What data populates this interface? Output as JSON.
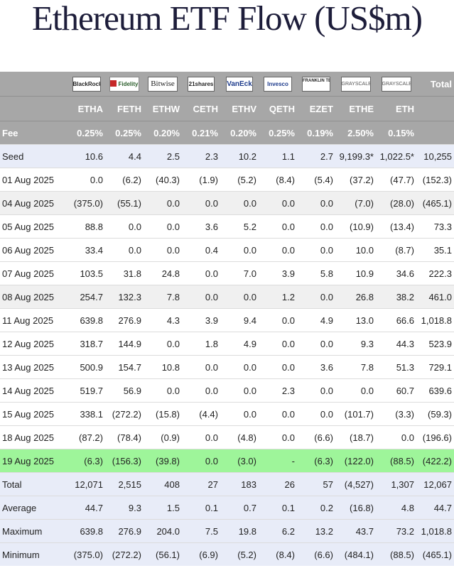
{
  "title": "Ethereum ETF Flow (US$m)",
  "issuers": [
    {
      "logo": "BlackRock",
      "icon": "blackrock-logo"
    },
    {
      "logo": "Fidelity",
      "icon": "fidelity-logo"
    },
    {
      "logo": "Bitwise",
      "icon": "bitwise-logo"
    },
    {
      "logo": "21shares",
      "icon": "21shares-logo"
    },
    {
      "logo": "VanEck",
      "icon": "vaneck-logo"
    },
    {
      "logo": "Invesco",
      "icon": "invesco-logo"
    },
    {
      "logo": "FRANKLIN TEMPLETON",
      "icon": "franklin-templeton-logo"
    },
    {
      "logo": "GRAYSCALE",
      "icon": "grayscale-logo"
    },
    {
      "logo": "GRAYSCALE",
      "icon": "grayscale-logo"
    }
  ],
  "total_header": "Total",
  "tickers": [
    "ETHA",
    "FETH",
    "ETHW",
    "CETH",
    "ETHV",
    "QETH",
    "EZET",
    "ETHE",
    "ETH"
  ],
  "fee_label": "Fee",
  "fees": [
    "0.25%",
    "0.25%",
    "0.20%",
    "0.21%",
    "0.20%",
    "0.25%",
    "0.19%",
    "2.50%",
    "0.15%"
  ],
  "rows": [
    {
      "label": "Seed",
      "style": "seed",
      "values": [
        "10.6",
        "4.4",
        "2.5",
        "2.3",
        "10.2",
        "1.1",
        "2.7",
        "9,199.3*",
        "1,022.5*",
        "10,255"
      ]
    },
    {
      "label": "01 Aug 2025",
      "style": "white",
      "values": [
        "0.0",
        "(6.2)",
        "(40.3)",
        "(1.9)",
        "(5.2)",
        "(8.4)",
        "(5.4)",
        "(37.2)",
        "(47.7)",
        "(152.3)"
      ]
    },
    {
      "label": "04 Aug 2025",
      "style": "gray",
      "values": [
        "(375.0)",
        "(55.1)",
        "0.0",
        "0.0",
        "0.0",
        "0.0",
        "0.0",
        "(7.0)",
        "(28.0)",
        "(465.1)"
      ]
    },
    {
      "label": "05 Aug 2025",
      "style": "white",
      "values": [
        "88.8",
        "0.0",
        "0.0",
        "3.6",
        "5.2",
        "0.0",
        "0.0",
        "(10.9)",
        "(13.4)",
        "73.3"
      ]
    },
    {
      "label": "06 Aug 2025",
      "style": "white",
      "values": [
        "33.4",
        "0.0",
        "0.0",
        "0.4",
        "0.0",
        "0.0",
        "0.0",
        "10.0",
        "(8.7)",
        "35.1"
      ]
    },
    {
      "label": "07 Aug 2025",
      "style": "white",
      "values": [
        "103.5",
        "31.8",
        "24.8",
        "0.0",
        "7.0",
        "3.9",
        "5.8",
        "10.9",
        "34.6",
        "222.3"
      ]
    },
    {
      "label": "08 Aug 2025",
      "style": "gray",
      "values": [
        "254.7",
        "132.3",
        "7.8",
        "0.0",
        "0.0",
        "1.2",
        "0.0",
        "26.8",
        "38.2",
        "461.0"
      ]
    },
    {
      "label": "11 Aug 2025",
      "style": "white",
      "values": [
        "639.8",
        "276.9",
        "4.3",
        "3.9",
        "9.4",
        "0.0",
        "4.9",
        "13.0",
        "66.6",
        "1,018.8"
      ]
    },
    {
      "label": "12 Aug 2025",
      "style": "white",
      "values": [
        "318.7",
        "144.9",
        "0.0",
        "1.8",
        "4.9",
        "0.0",
        "0.0",
        "9.3",
        "44.3",
        "523.9"
      ]
    },
    {
      "label": "13 Aug 2025",
      "style": "white",
      "values": [
        "500.9",
        "154.7",
        "10.8",
        "0.0",
        "0.0",
        "0.0",
        "3.6",
        "7.8",
        "51.3",
        "729.1"
      ]
    },
    {
      "label": "14 Aug 2025",
      "style": "white",
      "values": [
        "519.7",
        "56.9",
        "0.0",
        "0.0",
        "0.0",
        "2.3",
        "0.0",
        "0.0",
        "60.7",
        "639.6"
      ]
    },
    {
      "label": "15 Aug 2025",
      "style": "white",
      "values": [
        "338.1",
        "(272.2)",
        "(15.8)",
        "(4.4)",
        "0.0",
        "0.0",
        "0.0",
        "(101.7)",
        "(3.3)",
        "(59.3)"
      ]
    },
    {
      "label": "18 Aug 2025",
      "style": "white",
      "values": [
        "(87.2)",
        "(78.4)",
        "(0.9)",
        "0.0",
        "(4.8)",
        "0.0",
        "(6.6)",
        "(18.7)",
        "0.0",
        "(196.6)"
      ]
    },
    {
      "label": "19 Aug 2025",
      "style": "green",
      "values": [
        "(6.3)",
        "(156.3)",
        "(39.8)",
        "0.0",
        "(3.0)",
        "-",
        "(6.3)",
        "(122.0)",
        "(88.5)",
        "(422.2)"
      ]
    }
  ],
  "stats": [
    {
      "label": "Total",
      "values": [
        "12,071",
        "2,515",
        "408",
        "27",
        "183",
        "26",
        "57",
        "(4,527)",
        "1,307",
        "12,067"
      ]
    },
    {
      "label": "Average",
      "values": [
        "44.7",
        "9.3",
        "1.5",
        "0.1",
        "0.7",
        "0.1",
        "0.2",
        "(16.8)",
        "4.8",
        "44.7"
      ]
    },
    {
      "label": "Maximum",
      "values": [
        "639.8",
        "276.9",
        "204.0",
        "7.5",
        "19.8",
        "6.2",
        "13.2",
        "43.7",
        "73.2",
        "1,018.8"
      ]
    },
    {
      "label": "Minimum",
      "values": [
        "(375.0)",
        "(272.2)",
        "(56.1)",
        "(6.9)",
        "(5.2)",
        "(8.4)",
        "(6.6)",
        "(484.1)",
        "(88.5)",
        "(465.1)"
      ]
    }
  ],
  "colors": {
    "header_gray": "#a7a7a7",
    "negative": "#d12b2b",
    "highlight_green": "#9ef59a",
    "stat_bg": "#e8ecf8"
  }
}
